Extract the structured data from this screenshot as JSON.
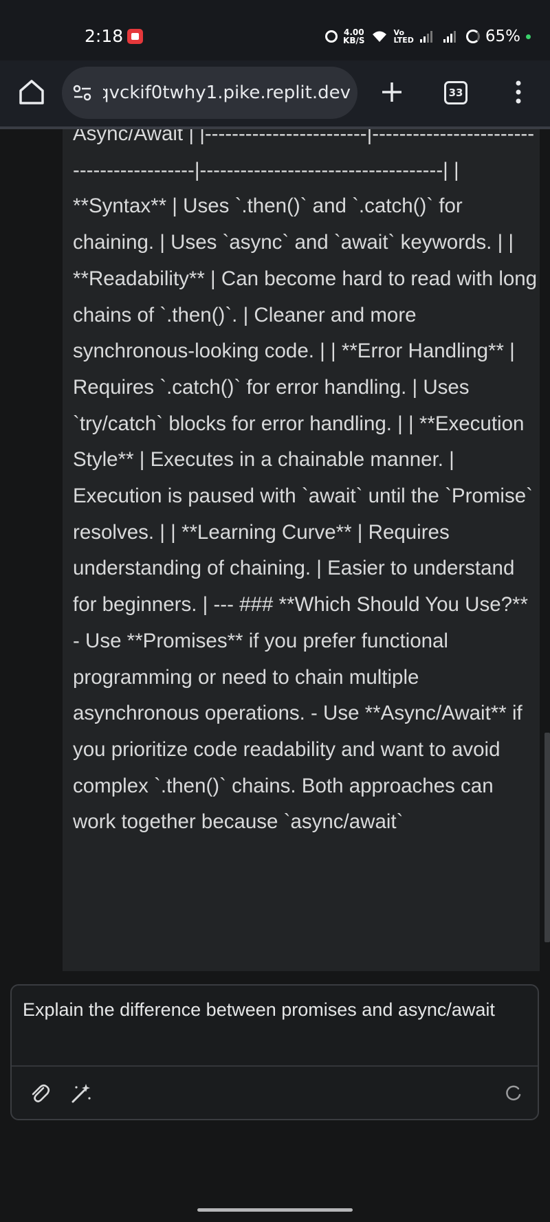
{
  "status_bar": {
    "time": "2:18",
    "net_speed_value": "4.00",
    "net_speed_unit": "KB/S",
    "volte_top": "Vo",
    "volte_bottom": "LTED",
    "battery": "65%",
    "icons": [
      "screen-record-icon",
      "alarm-icon",
      "wifi-icon",
      "signal-icon",
      "battery-icon"
    ]
  },
  "browser": {
    "url": "3qvckif0twhy1.pike.replit.dev",
    "tab_count": "33",
    "icons": [
      "home-icon",
      "site-settings-icon",
      "plus-icon",
      "tabs-icon",
      "more-vert-icon"
    ]
  },
  "chat": {
    "response_text": "Async/Await | |------------------------|------------------------------------------|------------------------------------| | **Syntax** | Uses `.then()` and `.catch()` for chaining. | Uses `async` and `await` keywords. | | **Readability** | Can become hard to read with long chains of `.then()`. | Cleaner and more synchronous-looking code. | | **Error Handling** | Requires `.catch()` for error handling. | Uses `try/catch` blocks for error handling. | | **Execution Style** | Executes in a chainable manner. | Execution is paused with `await` until the `Promise` resolves. | | **Learning Curve** | Requires understanding of chaining. | Easier to understand for beginners. | --- ### **Which Should You Use?** - Use **Promises** if you prefer functional programming or need to chain multiple asynchronous operations. - Use **Async/Await** if you prioritize code readability and want to avoid complex `.then()` chains. Both approaches can work together because `async/await`"
  },
  "composer": {
    "input_value": "Explain the difference between promises and async/await",
    "icons": [
      "paperclip-icon",
      "magic-wand-icon",
      "loading-spinner-icon"
    ]
  },
  "colors": {
    "background": "#151617",
    "card": "#222426",
    "text": "#d9dadb",
    "browser_bar": "#1c1f25",
    "recording": "#e5383b",
    "battery_dot": "#3ad16b"
  }
}
